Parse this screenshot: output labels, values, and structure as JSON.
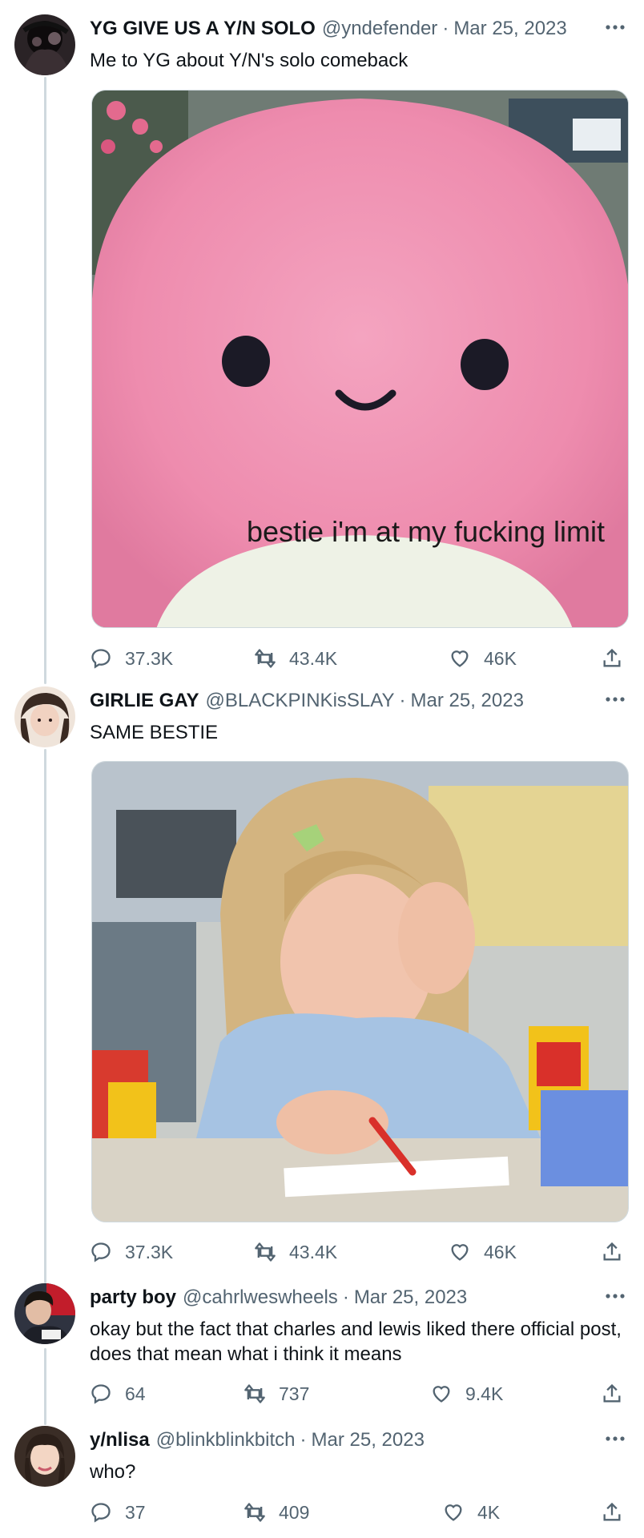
{
  "tweets": [
    {
      "name": "YG GIVE US A Y/N SOLO",
      "handle": "@yndefender",
      "date": "Mar 25, 2023",
      "text": "Me to YG about Y/N's solo comeback",
      "media_caption": "bestie i'm at my fucking limit",
      "replies": "37.3K",
      "retweets": "43.4K",
      "likes": "46K"
    },
    {
      "name": "GIRLIE GAY",
      "handle": "@BLACKPINKisSLAY",
      "date": "Mar 25, 2023",
      "text": "SAME BESTIE",
      "replies": "37.3K",
      "retweets": "43.4K",
      "likes": "46K"
    },
    {
      "name": "party boy",
      "handle": "@cahrlweswheels",
      "date": "Mar 25, 2023",
      "text": "okay but the fact that charles and lewis liked there official post, does that mean what i think it means",
      "replies": "64",
      "retweets": "737",
      "likes": "9.4K"
    },
    {
      "name": "y/nlisa",
      "handle": "@blinkblinkbitch",
      "date": "Mar 25, 2023",
      "text": "who?",
      "replies": "37",
      "retweets": "409",
      "likes": "4K"
    }
  ],
  "separator": "·",
  "icons": {
    "reply": "reply-bubble-icon",
    "retweet": "retweet-arrows-icon",
    "like": "heart-icon",
    "share": "share-upload-icon",
    "more": "more-dots-icon"
  },
  "colors": {
    "text": "#0f1419",
    "secondary": "#536471",
    "thread_line": "#cfd9de",
    "squish_pink": "#ef8fb0"
  }
}
